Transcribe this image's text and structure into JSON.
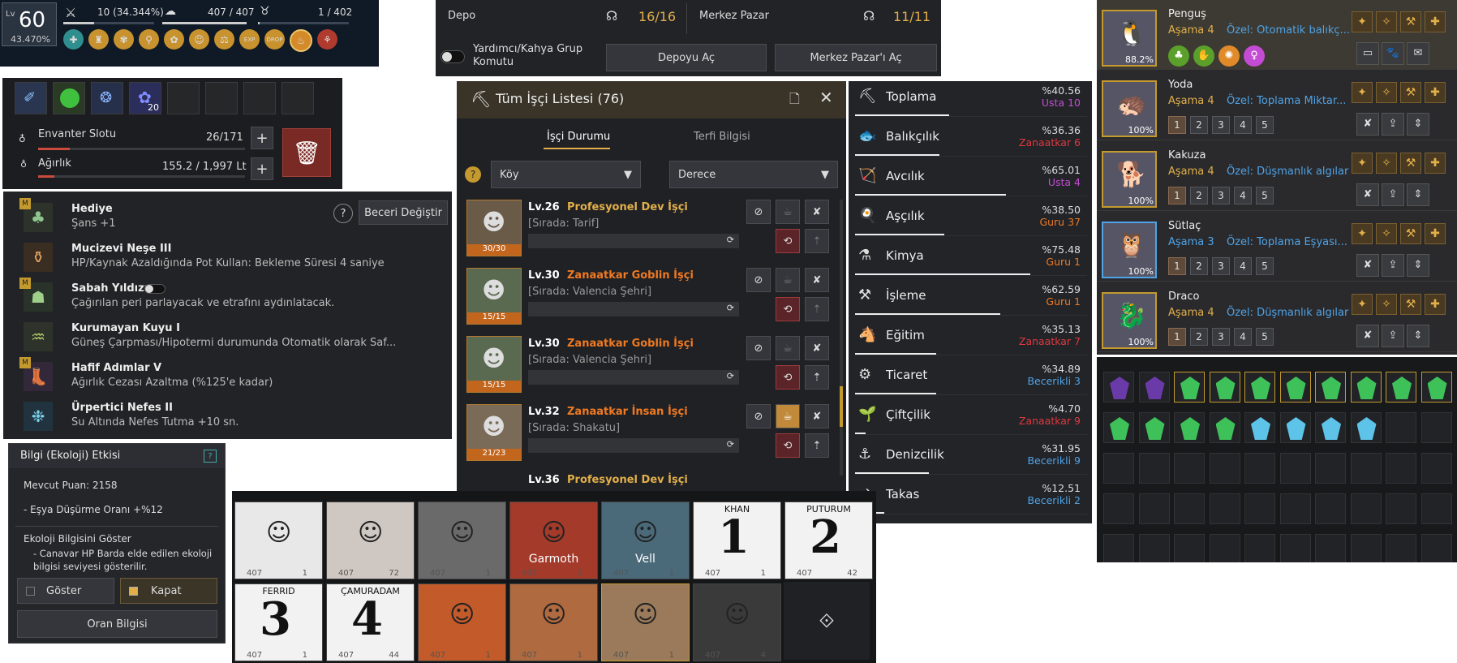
{
  "hud": {
    "lv_label": "Lv",
    "level": "60",
    "percent": "43.470%",
    "stat1": "10 (34.344%)",
    "stat2": "407 / 407",
    "stat3": "1 / 402",
    "buffs": [
      "buff-icon",
      "buff-icon",
      "buff-icon",
      "buff-icon",
      "buff-icon",
      "buff-icon",
      "buff-icon",
      "EXP",
      "DROP",
      "buff-icon",
      "buff-icon"
    ]
  },
  "depo": {
    "depo_label": "Depo",
    "depo_count": "16/16",
    "pazar_label": "Merkez Pazar",
    "pazar_count": "11/11",
    "toggle_label": "Yardımcı/Kahya Grup Komutu",
    "open_depo": "Depoyu Aç",
    "open_pazar": "Merkez Pazar'ı Aç"
  },
  "inventory": {
    "gem_count": "20",
    "slot_label": "Envanter Slotu",
    "slot_value": "26/171",
    "weight_label": "Ağırlık",
    "weight_value": "155.2 / 1,997 Lt",
    "slot_fill": 0.152,
    "weight_fill": 0.078
  },
  "skills": {
    "change_button": "Beceri Değiştir",
    "items": [
      {
        "name": "Hediye",
        "desc": "Şans +1",
        "badge": "M"
      },
      {
        "name": "Mucizevi Neşe III",
        "desc": "HP/Kaynak Azaldığında Pot Kullan: Bekleme Süresi 4 saniye",
        "badge": ""
      },
      {
        "name": "Sabah Yıldızı",
        "desc": "Çağırılan peri parlayacak ve etrafını aydınlatacak.",
        "badge": "M"
      },
      {
        "name": "Kurumayan Kuyu I",
        "desc": "Güneş Çarpması/Hipotermi durumunda Otomatik olarak Saf...",
        "badge": ""
      },
      {
        "name": "Hafif Adımlar V",
        "desc": "Ağırlık Cezası Azaltma (%125'e kadar)",
        "badge": "M"
      },
      {
        "name": "Ürpertici Nefes II",
        "desc": "Su Altında Nefes Tutma +10 sn.",
        "badge": ""
      }
    ]
  },
  "eco": {
    "title": "Bilgi (Ekoloji) Etkisi",
    "points_label": "Mevcut Puan:",
    "points": "2158",
    "drop": "- Eşya Düşürme Oranı +%12",
    "show_title": "Ekoloji Bilgisini Göster",
    "note": "- Canavar HP Barda elde edilen ekoloji bilgisi seviyesi gösterilir.",
    "show_btn": "Göster",
    "hide_btn": "Kapat",
    "rate_btn": "Oran Bilgisi"
  },
  "workers": {
    "title": "Tüm İşçi Listesi (76)",
    "tab1": "İşçi Durumu",
    "tab2": "Terfi Bilgisi",
    "filter1": "Köy",
    "filter2": "Derece",
    "list": [
      {
        "lv": "Lv.26",
        "name": "Profesyonel Dev İşçi",
        "task": "[Sırada: Tarif]",
        "stamina": "30/30",
        "tier": "gold"
      },
      {
        "lv": "Lv.30",
        "name": "Zanaatkar Goblin İşçi",
        "task": "[Sırada: Valencia Şehri]",
        "stamina": "15/15",
        "tier": "orange"
      },
      {
        "lv": "Lv.30",
        "name": "Zanaatkar Goblin İşçi",
        "task": "[Sırada: Valencia Şehri]",
        "stamina": "15/15",
        "tier": "orange"
      },
      {
        "lv": "Lv.32",
        "name": "Zanaatkar İnsan İşçi",
        "task": "[Sırada: Shakatu]",
        "stamina": "21/23",
        "tier": "orange"
      },
      {
        "lv": "Lv.36",
        "name": "Profesyonel Dev İşçi",
        "task": "",
        "stamina": "",
        "tier": "gold"
      }
    ]
  },
  "lifeskills": [
    {
      "name": "Toplama",
      "pct": "%40.56",
      "rank": "Usta 10",
      "color": "#c44bd3",
      "fill": 0.4056
    },
    {
      "name": "Balıkçılık",
      "pct": "%36.36",
      "rank": "Zanaatkar 6",
      "color": "#e0383f",
      "fill": 0.3636
    },
    {
      "name": "Avcılık",
      "pct": "%65.01",
      "rank": "Usta 4",
      "color": "#c44bd3",
      "fill": 0.6501
    },
    {
      "name": "Aşçılık",
      "pct": "%38.50",
      "rank": "Guru 37",
      "color": "#f07a22",
      "fill": 0.385
    },
    {
      "name": "Kimya",
      "pct": "%75.48",
      "rank": "Guru 1",
      "color": "#f07a22",
      "fill": 0.7548
    },
    {
      "name": "İşleme",
      "pct": "%62.59",
      "rank": "Guru 1",
      "color": "#f07a22",
      "fill": 0.6259
    },
    {
      "name": "Eğitim",
      "pct": "%35.13",
      "rank": "Zanaatkar 7",
      "color": "#e0383f",
      "fill": 0.3513
    },
    {
      "name": "Ticaret",
      "pct": "%34.89",
      "rank": "Becerikli 3",
      "color": "#4fa3e6",
      "fill": 0.3489
    },
    {
      "name": "Çiftçilik",
      "pct": "%4.70",
      "rank": "Zanaatkar 9",
      "color": "#e0383f",
      "fill": 0.047
    },
    {
      "name": "Denizcilik",
      "pct": "%31.95",
      "rank": "Becerikli 9",
      "color": "#4fa3e6",
      "fill": 0.3195
    },
    {
      "name": "Takas",
      "pct": "%12.51",
      "rank": "Becerikli 2",
      "color": "#4fa3e6",
      "fill": 0.1251
    }
  ],
  "pets": [
    {
      "name": "Penguş",
      "stage": "Aşama 4",
      "special": "Özel: Otomatik balıkç...",
      "pct": "88.2%",
      "stagecolor": "#e2b04a",
      "specialcolor": "#4fa3e6"
    },
    {
      "name": "Yoda",
      "stage": "Aşama 4",
      "special": "Özel: Toplama Miktar...",
      "pct": "100%",
      "stagecolor": "#e2b04a",
      "specialcolor": "#4fa3e6"
    },
    {
      "name": "Kakuza",
      "stage": "Aşama 4",
      "special": "Özel: Düşmanlık algılar",
      "pct": "100%",
      "stagecolor": "#e2b04a",
      "specialcolor": "#4fa3e6"
    },
    {
      "name": "Sütlaç",
      "stage": "Aşama 3",
      "special": "Özel: Toplama Eşyası...",
      "pct": "100%",
      "stagecolor": "#4fa3e6",
      "specialcolor": "#4fa3e6"
    },
    {
      "name": "Draco",
      "stage": "Aşama 4",
      "special": "Özel: Düşmanlık algılar",
      "pct": "100%",
      "stagecolor": "#e2b04a",
      "specialcolor": "#4fa3e6"
    }
  ],
  "pet_tabs": [
    "1",
    "2",
    "3",
    "4",
    "5"
  ],
  "characters": [
    {
      "label": "",
      "count": "1",
      "energy": "407"
    },
    {
      "label": "",
      "count": "72",
      "energy": "407"
    },
    {
      "label": "",
      "count": "1",
      "energy": "407"
    },
    {
      "label": "Garmoth",
      "count": "1",
      "energy": "407"
    },
    {
      "label": "Vell",
      "count": "1",
      "energy": "407"
    },
    {
      "label": "KHAN",
      "count": "1",
      "energy": "407",
      "big": "1"
    },
    {
      "label": "PUTURUM",
      "count": "42",
      "energy": "407",
      "big": "2"
    },
    {
      "label": "FERRID",
      "count": "1",
      "energy": "407",
      "big": "3"
    },
    {
      "label": "ÇAMURADAM",
      "count": "44",
      "energy": "407",
      "big": "4"
    },
    {
      "label": "",
      "count": "1",
      "energy": "407"
    },
    {
      "label": "",
      "count": "1",
      "energy": "407"
    },
    {
      "label": "",
      "count": "1",
      "energy": "407"
    },
    {
      "label": "",
      "count": "4",
      "energy": "407"
    }
  ]
}
